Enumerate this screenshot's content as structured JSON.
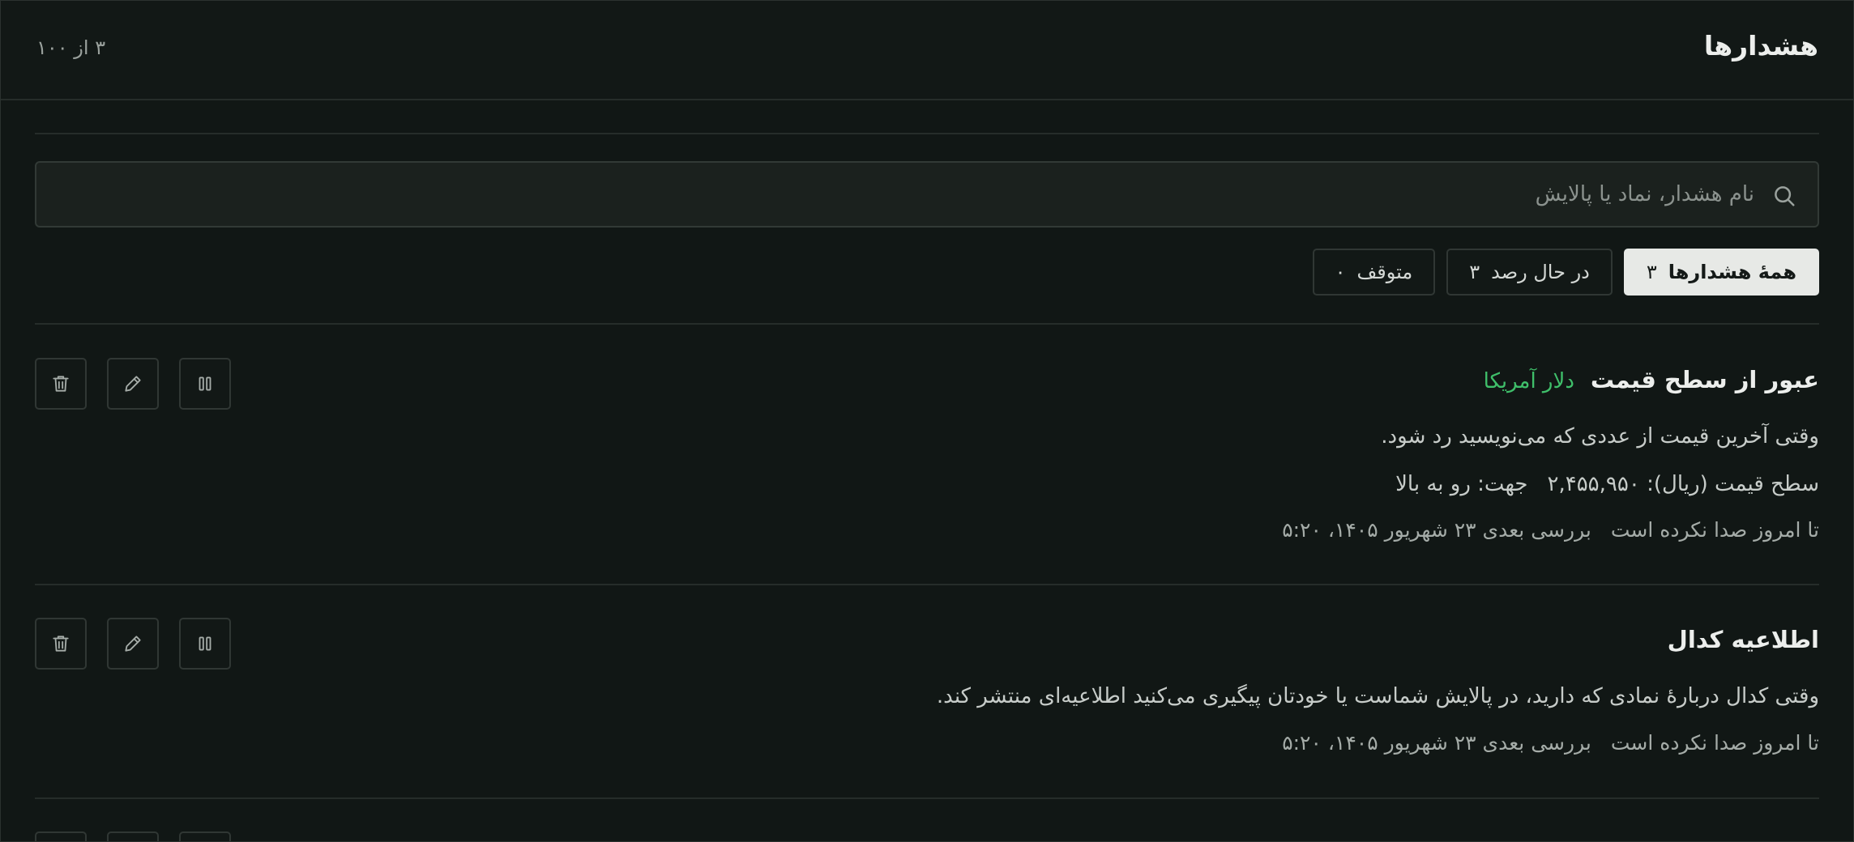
{
  "header": {
    "title": "هشدارها",
    "count": "۳ از ۱۰۰"
  },
  "search": {
    "placeholder": "نام هشدار، نماد یا پالایش",
    "value": ""
  },
  "tabs": [
    {
      "label": "همهٔ هشدارها",
      "count": "۳",
      "active": true
    },
    {
      "label": "در حال رصد",
      "count": "۳",
      "active": false
    },
    {
      "label": "متوقف",
      "count": "۰",
      "active": false
    }
  ],
  "alerts": [
    {
      "name": "عبور از سطح قیمت",
      "symbol": "دلار آمریکا",
      "description": "وقتی آخرین قیمت از عددی که می‌نویسید رد شود.",
      "params": {
        "price_level": "سطح قیمت (ریال): ۲,۴۵۵,۹۵۰",
        "direction": "جهت: رو به بالا"
      },
      "status": "تا امروز صدا نکرده است",
      "next_check": "بررسی بعدی ۲۳ شهریور ۱۴۰۵، ۵:۲۰"
    },
    {
      "name": "اطلاعیه کدال",
      "symbol": "",
      "description": "وقتی کدال دربارهٔ نمادی که دارید، در پالایش شماست یا خودتان پیگیری می‌کنید اطلاعیه‌ای منتشر کند.",
      "status": "تا امروز صدا نکرده است",
      "next_check": "بررسی بعدی ۲۳ شهریور ۱۴۰۵، ۵:۲۰"
    }
  ],
  "icons": {
    "search": "search-icon",
    "pause": "pause-icon",
    "edit": "pencil-icon",
    "delete": "trash-icon"
  },
  "colors": {
    "accent_green": "#3fbf6a",
    "background": "#111715",
    "active_tab": "#e7e9e6"
  }
}
